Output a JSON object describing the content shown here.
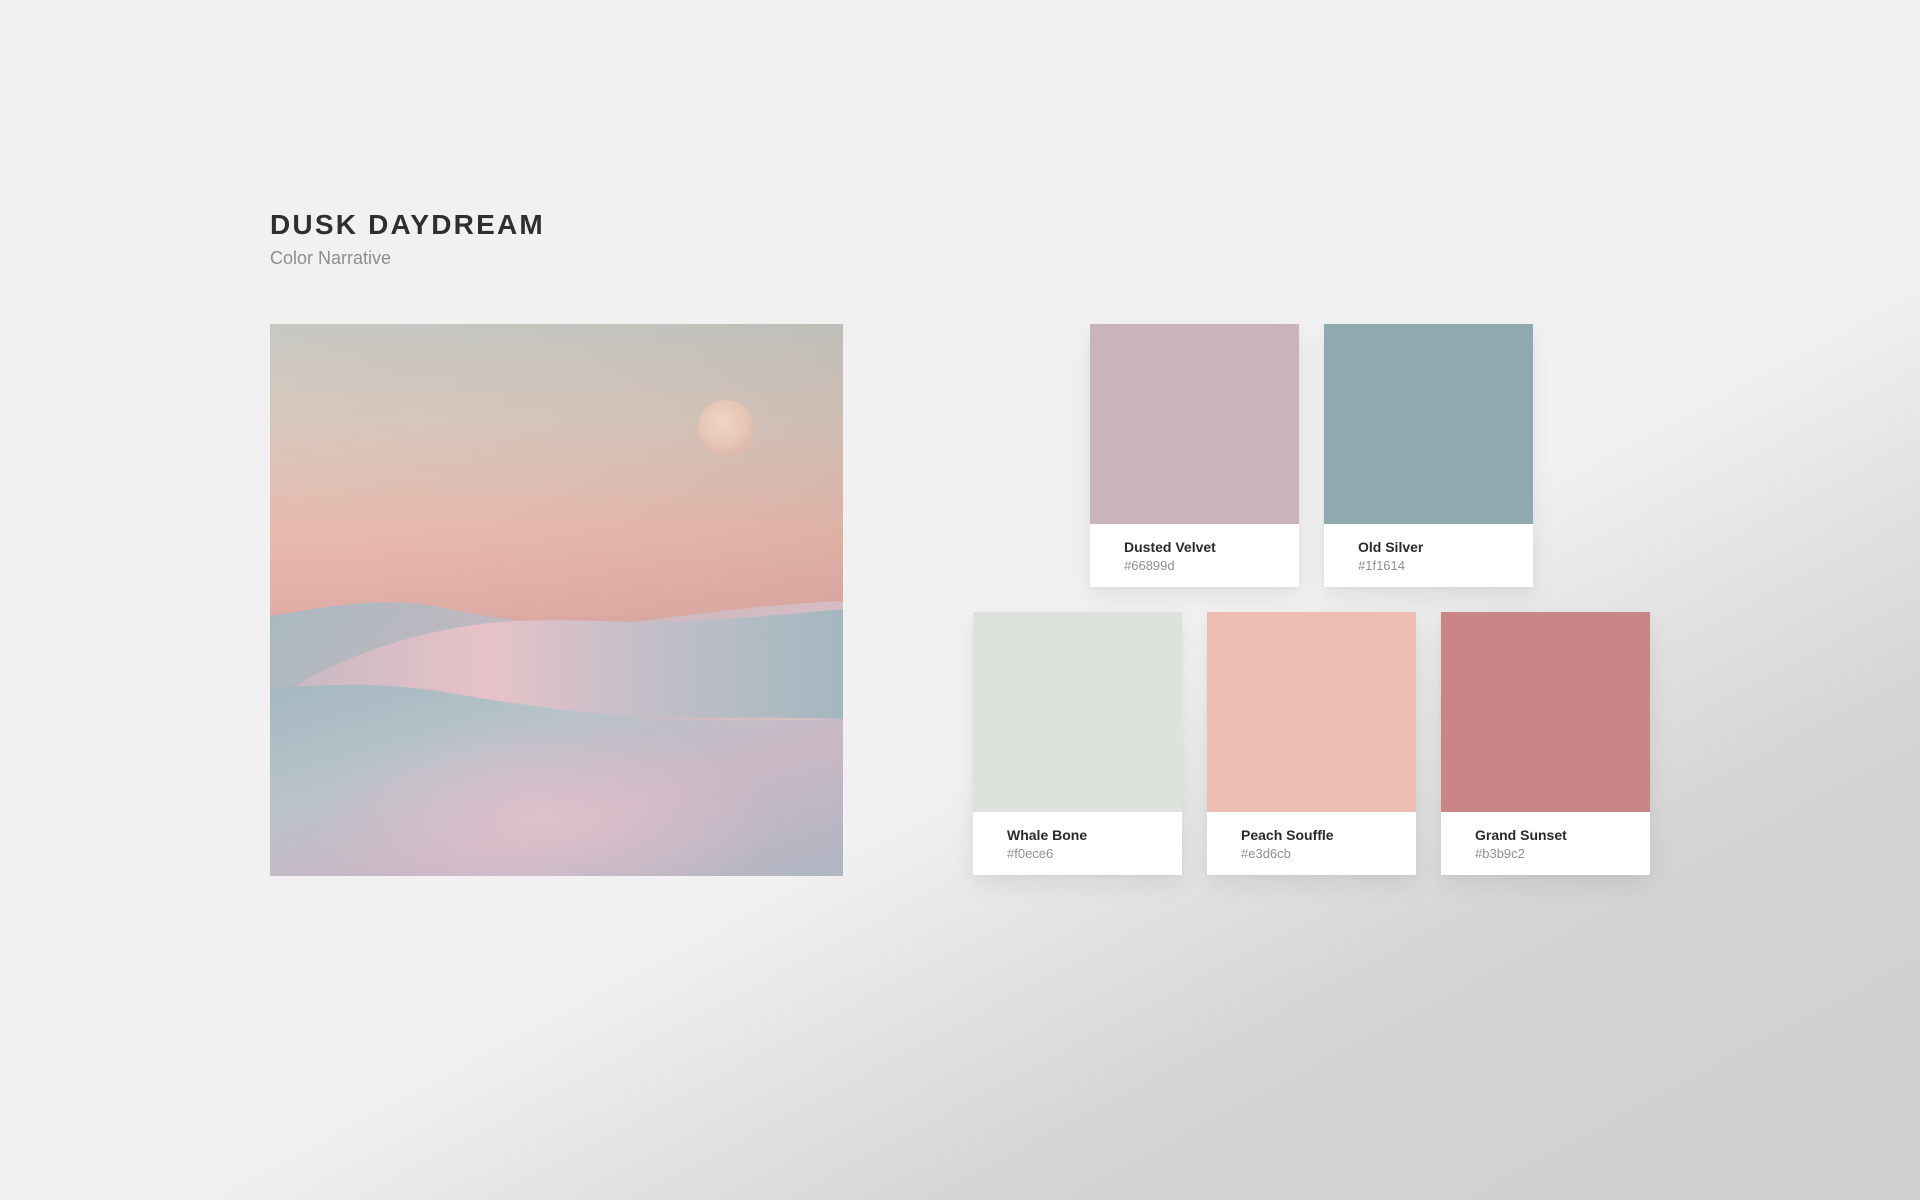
{
  "header": {
    "title": "DUSK DAYDREAM",
    "subtitle": "Color Narrative"
  },
  "photo": {
    "description_icon": "desert-dunes-moon-photo"
  },
  "swatches": [
    {
      "name": "Dusted Velvet",
      "hex": "#66899d",
      "color": "#c9b4b9"
    },
    {
      "name": "Old Silver",
      "hex": "#1f1614",
      "color": "#8eaab0"
    },
    {
      "name": "Whale Bone",
      "hex": "#f0ece6",
      "color": "#dde2dc"
    },
    {
      "name": "Peach Souffle",
      "hex": "#e3d6cb",
      "color": "#ebbdb3"
    },
    {
      "name": "Grand Sunset",
      "hex": "#b3b9c2",
      "color": "#c98687"
    }
  ]
}
